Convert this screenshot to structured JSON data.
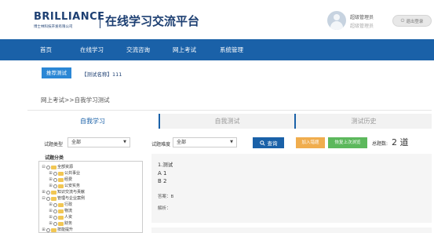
{
  "header": {
    "brand": "BRILLIANCE",
    "brand_sub": "博士林科技开发有限公司",
    "app_title": "在线学习交流平台",
    "user_role": "超级管理员",
    "user_name": "超级管理员",
    "logout_label": "退出登录"
  },
  "nav": {
    "items": [
      {
        "label": "首页"
      },
      {
        "label": "在线学习"
      },
      {
        "label": "交流咨询"
      },
      {
        "label": "网上考试"
      },
      {
        "label": "系统管理"
      }
    ]
  },
  "notice": {
    "button_label": "推荐测试",
    "text": "【测试名称】111"
  },
  "breadcrumb": "网上考试>>自我学习测试",
  "tabs": [
    {
      "label": "自我学习",
      "active": true
    },
    {
      "label": "自我测试",
      "active": false
    },
    {
      "label": "测试历史",
      "active": false
    }
  ],
  "filters": {
    "type_label": "试题类型",
    "type_value": "全部",
    "difficulty_label": "试题难度",
    "difficulty_value": "全部",
    "search_label": "查询",
    "add_wrong_label": "加入错题",
    "restore_label": "恢复上次浏览",
    "total_label": "总题数:",
    "total_value": "2 道"
  },
  "tree": {
    "title": "试题分类",
    "items": [
      {
        "label": "全部资源",
        "level": 0,
        "toggle": "⊟"
      },
      {
        "label": "公共事业",
        "level": 1,
        "toggle": "⊞"
      },
      {
        "label": "经费",
        "level": 1,
        "toggle": "⊞"
      },
      {
        "label": "公安实务",
        "level": 1,
        "toggle": "⊞"
      },
      {
        "label": "知识交流与贡献",
        "level": 0,
        "toggle": "⊞"
      },
      {
        "label": "管理与企业案例",
        "level": 0,
        "toggle": "⊟"
      },
      {
        "label": "行政",
        "level": 1,
        "toggle": "⊞"
      },
      {
        "label": "物流",
        "level": 1,
        "toggle": "⊞"
      },
      {
        "label": "人资",
        "level": 1,
        "toggle": "⊞"
      },
      {
        "label": "财务",
        "level": 1,
        "toggle": "⊞"
      },
      {
        "label": "技能提升",
        "level": 0,
        "toggle": "⊞"
      }
    ]
  },
  "question": {
    "title": "1.测试",
    "option_a": "A 1",
    "option_b": "B 2",
    "answer": "答案：B",
    "analysis": "解析："
  },
  "colors": {
    "nav_bg": "#1a61a8",
    "notice_btn": "#2b87d5",
    "orange": "#f0ad4e",
    "green": "#5cb85c"
  }
}
